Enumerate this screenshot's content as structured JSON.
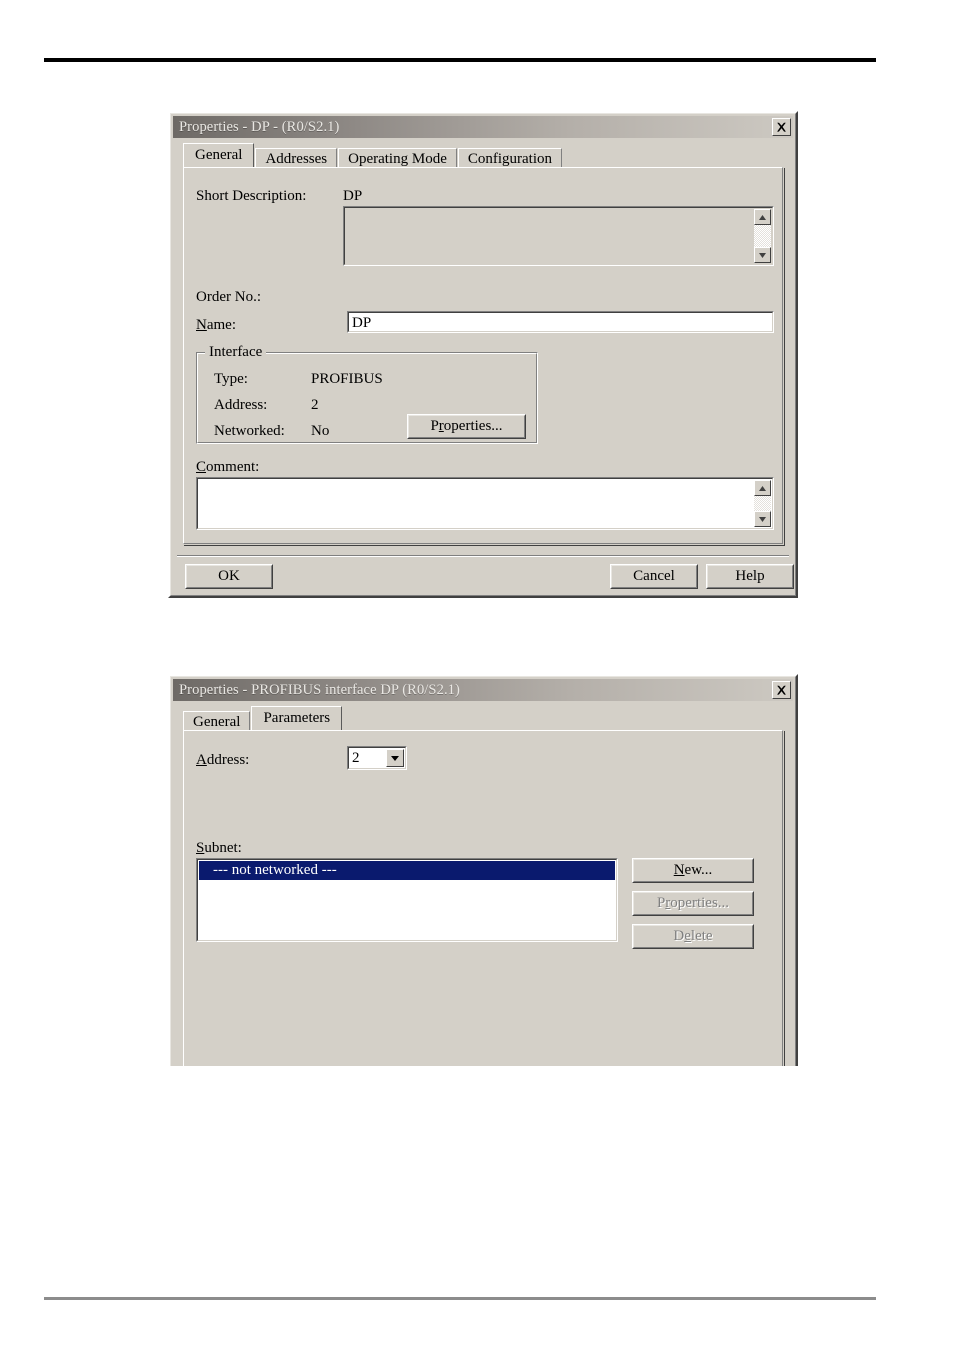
{
  "page": {
    "rules": {
      "top_color": "#000000",
      "bottom_color": "#8c8c8c"
    }
  },
  "dialog1": {
    "title": "Properties - DP - (R0/S2.1)",
    "close_icon": "close-icon",
    "tabs": [
      {
        "label": "General",
        "active": true
      },
      {
        "label": "Addresses",
        "active": false
      },
      {
        "label": "Operating Mode",
        "active": false
      },
      {
        "label": "Configuration",
        "active": false
      }
    ],
    "short_description_label": "Short Description:",
    "short_description_value": "DP",
    "short_description_box_text": "",
    "order_no_label": "Order No.:",
    "order_no_value": "",
    "name_label_prefix": "N",
    "name_label_suffix": "ame:",
    "name_value": "DP",
    "interface": {
      "legend": "Interface",
      "type_label": "Type:",
      "type_value": "PROFIBUS",
      "address_label": "Address:",
      "address_value": "2",
      "networked_label": "Networked:",
      "networked_value": "No",
      "properties_button_prefix": "P",
      "properties_button_accel": "r",
      "properties_button_suffix": "operties..."
    },
    "comment_label_prefix": "C",
    "comment_label_suffix": "omment:",
    "comment_value": "",
    "buttons": {
      "ok": "OK",
      "cancel": "Cancel",
      "help": "Help"
    }
  },
  "dialog2": {
    "title": "Properties - PROFIBUS interface  DP (R0/S2.1)",
    "close_icon": "close-icon",
    "tabs": [
      {
        "label": "General",
        "active": false
      },
      {
        "label": "Parameters",
        "active": true
      }
    ],
    "address_label_prefix": "A",
    "address_label_suffix": "ddress:",
    "address_value": "2",
    "address_options": [
      "2"
    ],
    "subnet_label_prefix": "S",
    "subnet_label_suffix": "ubnet:",
    "subnet_items": [
      {
        "label": "--- not networked ---",
        "selected": true
      }
    ],
    "buttons": {
      "new_prefix": "N",
      "new_suffix": "ew...",
      "new_enabled": true,
      "properties_prefix": "P",
      "properties_accel": "r",
      "properties_suffix": "operties...",
      "properties_enabled": false,
      "delete_prefix": "D",
      "delete_accel": "e",
      "delete_suffix": "lete",
      "delete_enabled": false
    }
  },
  "colors": {
    "dialog_face": "#d4d0c8",
    "selection": "#0a1a6e",
    "title_text": "#e9e7e3",
    "disabled_text": "#808080"
  }
}
